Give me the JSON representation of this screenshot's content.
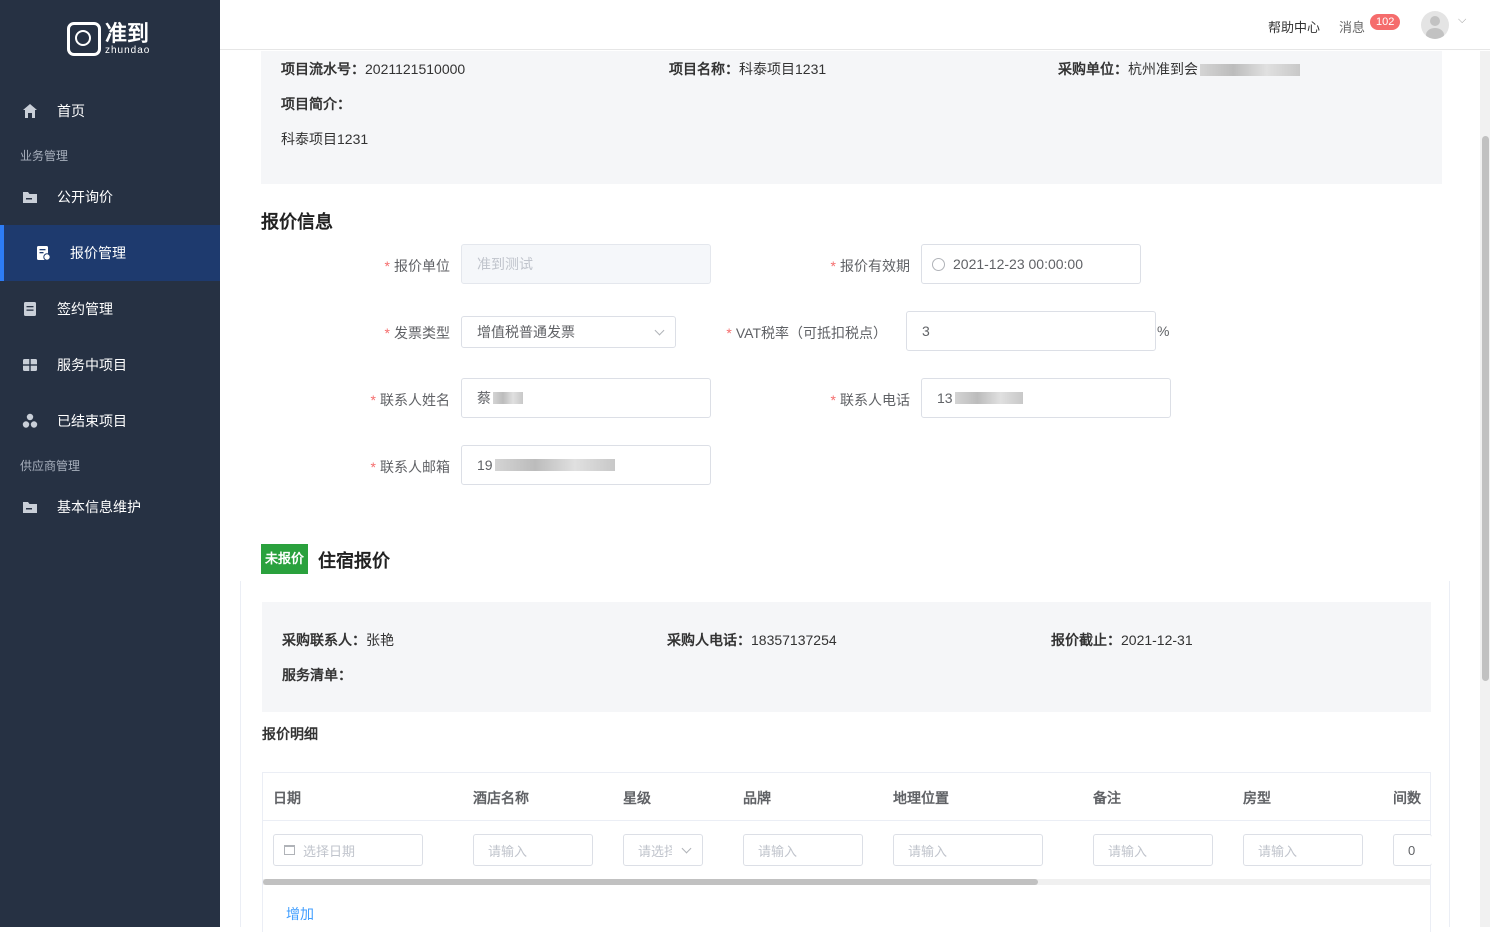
{
  "brand": {
    "cn": "准到",
    "en": "zhundao"
  },
  "sidebar": {
    "home": "首页",
    "group_business": "业务管理",
    "items": [
      {
        "label": "公开询价"
      },
      {
        "label": "报价管理"
      },
      {
        "label": "签约管理"
      },
      {
        "label": "服务中项目"
      },
      {
        "label": "已结束项目"
      }
    ],
    "group_supplier": "供应商管理",
    "supplier_items": [
      {
        "label": "基本信息维护"
      }
    ]
  },
  "topbar": {
    "help": "帮助中心",
    "messages": "消息",
    "message_count": "102"
  },
  "project": {
    "serial_label": "项目流水号：",
    "serial_value": "2021121510000",
    "name_label": "项目名称：",
    "name_value": "科泰项目1231",
    "buyer_label": "采购单位：",
    "buyer_value": "杭州准到会",
    "intro_label": "项目简介：",
    "intro_value": "科泰项目1231"
  },
  "quote_info": {
    "title": "报价信息",
    "unit_label": "报价单位",
    "unit_placeholder": "准到测试",
    "validity_label": "报价有效期",
    "validity_value": "2021-12-23 00:00:00",
    "invoice_label": "发票类型",
    "invoice_value": "增值税普通发票",
    "vat_label": "VAT税率（可抵扣税点）",
    "vat_value": "3",
    "vat_unit": "%",
    "contact_name_label": "联系人姓名",
    "contact_name_value": "蔡",
    "contact_phone_label": "联系人电话",
    "contact_phone_value": "13",
    "contact_email_label": "联系人邮箱",
    "contact_email_value": "19"
  },
  "hotel": {
    "status_tag": "未报价",
    "title": "住宿报价",
    "buyer_contact_label": "采购联系人：",
    "buyer_contact_value": "张艳",
    "buyer_phone_label": "采购人电话：",
    "buyer_phone_value": "18357137254",
    "deadline_label": "报价截止：",
    "deadline_value": "2021-12-31",
    "service_list_label": "服务清单：",
    "detail_title": "报价明细",
    "columns": [
      "日期",
      "酒店名称",
      "星级",
      "品牌",
      "地理位置",
      "备注",
      "房型",
      "间数"
    ],
    "row": {
      "date_placeholder": "选择日期",
      "hotel_placeholder": "请输入",
      "star_placeholder": "请选择",
      "brand_placeholder": "请输入",
      "location_placeholder": "请输入",
      "remark_placeholder": "请输入",
      "room_type_placeholder": "请输入",
      "rooms_value": "0"
    },
    "add_label": "增加"
  }
}
